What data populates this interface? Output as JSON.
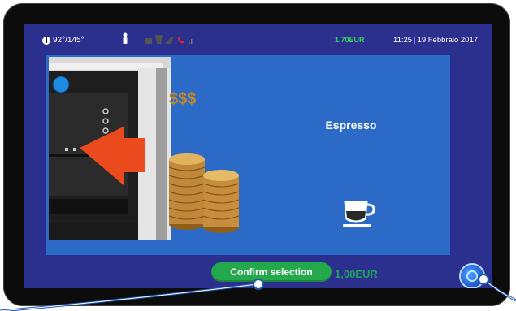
{
  "status_bar": {
    "temperature": "92°/145°",
    "balance": "1,70EUR",
    "time": "11:25",
    "date": "19 Febbraio 2017"
  },
  "product": {
    "name": "Espresso",
    "price": "1,00EUR",
    "image_text": "$$$"
  },
  "actions": {
    "confirm_label": "Confirm selection"
  },
  "icons": [
    "thermometer-icon",
    "person-icon",
    "cup-icon",
    "bean-icon",
    "tool-icon",
    "phone-icon",
    "signal-icon",
    "espresso-cup-icon",
    "coin-icon"
  ],
  "colors": {
    "screen_bg": "#2b2f8e",
    "panel_bg": "#2c6ac7",
    "accent_green": "#23a84c",
    "balance_green": "#37d25c"
  }
}
